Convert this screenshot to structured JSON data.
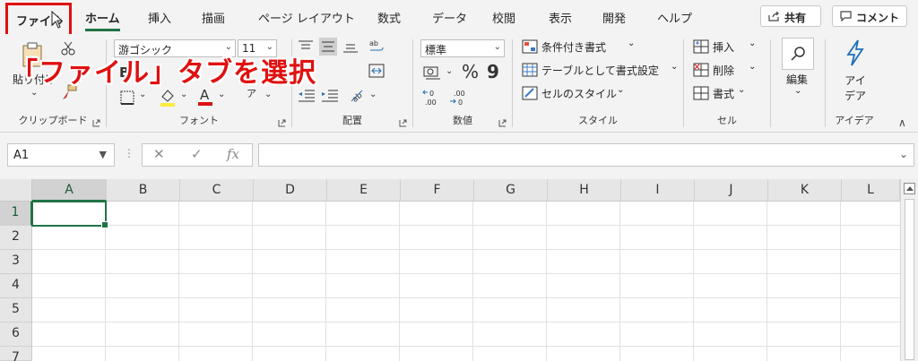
{
  "tabs": {
    "file": "ファイル",
    "items": [
      "ホーム",
      "挿入",
      "描画",
      "ページ レイアウト",
      "数式",
      "データ",
      "校閲",
      "表示",
      "開発",
      "ヘルプ"
    ]
  },
  "header": {
    "share": "共有",
    "comment": "コメント"
  },
  "callout": "「ファイル」タブを選択",
  "ribbon": {
    "clipboard": {
      "label": "クリップボード",
      "paste": "貼り付け"
    },
    "font": {
      "label": "フォント",
      "name": "游ゴシック",
      "size": "11",
      "bold": "B",
      "phonetic": "ア"
    },
    "align": {
      "label": "配置"
    },
    "number": {
      "label": "数値",
      "format": "標準",
      "percent": "%",
      "comma": "9"
    },
    "style": {
      "label": "スタイル",
      "items": [
        "条件付き書式",
        "テーブルとして書式設定",
        "セルのスタイル"
      ]
    },
    "cells": {
      "label": "セル",
      "items": [
        "挿入",
        "削除",
        "書式"
      ]
    },
    "edit": {
      "label": "編集"
    },
    "ideas": {
      "label": "アイデア",
      "button": "アイ デア"
    }
  },
  "formula_bar": {
    "name_box": "A1",
    "cancel": "✕",
    "enter": "✓",
    "fx": "fx",
    "value": ""
  },
  "grid": {
    "columns": [
      "A",
      "B",
      "C",
      "D",
      "E",
      "F",
      "G",
      "H",
      "I",
      "J",
      "K",
      "L"
    ],
    "rows": [
      "1",
      "2",
      "3",
      "4",
      "5",
      "6",
      "7"
    ],
    "active_cell": "A1"
  },
  "colors": {
    "accent": "#217346",
    "callout": "#e01010",
    "ribbon_bg": "#f3f3f3"
  }
}
